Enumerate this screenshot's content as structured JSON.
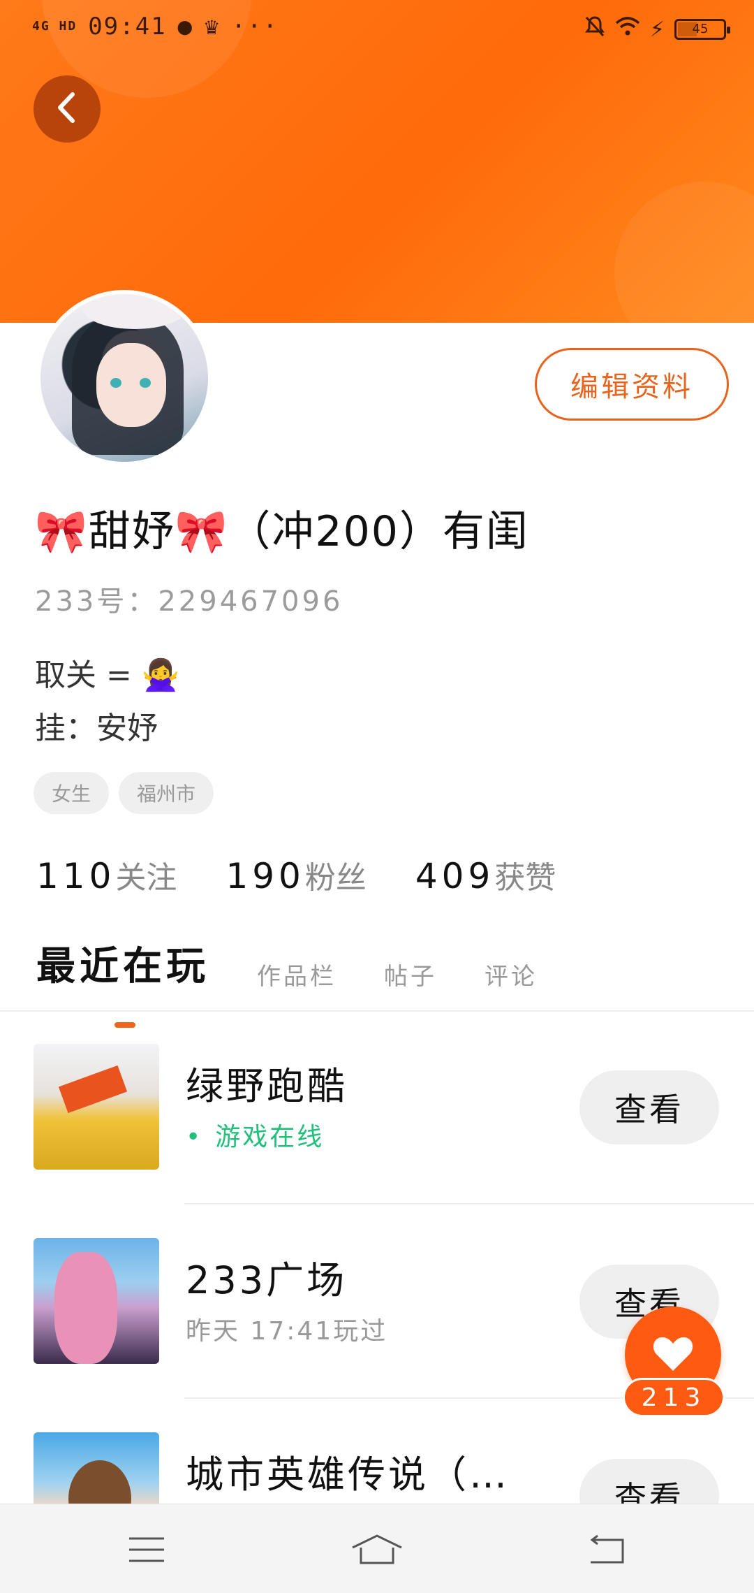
{
  "status_bar": {
    "network": "4G HD",
    "time": "09:41",
    "battery": "45"
  },
  "profile": {
    "edit_button": "编辑资料",
    "nickname": "🎀甜妤🎀（冲200）有闺",
    "uid": "233号：229467096",
    "bio_line1": "取关 = 🙅‍♀️",
    "bio_line2": "挂：安妤",
    "tags": [
      "女生",
      "福州市"
    ],
    "stats": {
      "following_num": "110",
      "following_label": "关注",
      "fans_num": "190",
      "fans_label": "粉丝",
      "likes_num": "409",
      "likes_label": "获赞"
    }
  },
  "tabs": [
    "最近在玩",
    "作品栏",
    "帖子",
    "评论"
  ],
  "games": [
    {
      "title": "绿野跑酷",
      "subtitle": "游戏在线",
      "button": "查看"
    },
    {
      "title": "233广场",
      "subtitle": "昨天  17:41玩过",
      "button": "查看"
    },
    {
      "title": "城市英雄传说（…",
      "subtitle": "",
      "button": "查看"
    }
  ],
  "like": {
    "count": "213"
  },
  "icons": {
    "back": "chevron-left-icon",
    "like": "heart-icon",
    "nav_menu": "menu-icon",
    "nav_home": "home-icon",
    "nav_back": "back-icon"
  },
  "colors": {
    "accent": "#ff6a0a",
    "online": "#21c07a"
  }
}
